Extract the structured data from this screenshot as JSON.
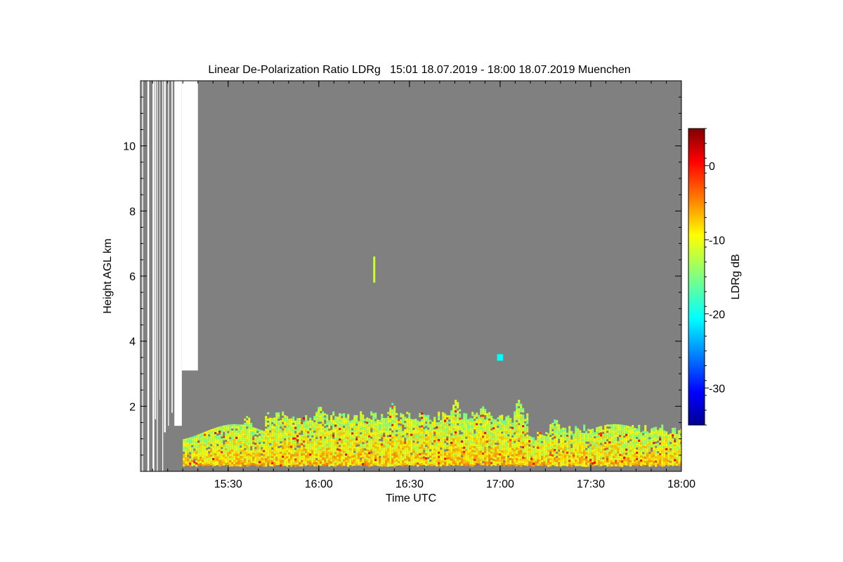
{
  "chart_data": {
    "type": "heatmap",
    "title": "Linear De-Polarization Ratio LDRg   15:01 18.07.2019 - 18:00 18.07.2019 Muenchen",
    "xlabel": "Time UTC",
    "ylabel": "Height AGL km",
    "x_range": [
      "15:01",
      "18:00"
    ],
    "y_range": [
      0,
      12
    ],
    "x_ticks": [
      "15:30",
      "16:00",
      "16:30",
      "17:00",
      "17:30",
      "18:00"
    ],
    "y_ticks": [
      2,
      4,
      6,
      8,
      10
    ],
    "grid": false,
    "background_color": "#808080",
    "colorbar": {
      "label": "LDRg dB",
      "range": [
        -35,
        5
      ],
      "ticks": [
        0,
        -10,
        -20,
        -30
      ],
      "tick_labels": [
        "0",
        "-10",
        "-20",
        "-30"
      ],
      "colormap": "jet"
    },
    "regions": [
      {
        "name": "no-data gaps",
        "x": [
          "15:01",
          "15:20"
        ],
        "y": [
          0,
          12
        ],
        "color": "#ffffff"
      },
      {
        "name": "boundary-layer scatter",
        "x": [
          "15:15",
          "18:00"
        ],
        "y": [
          0.2,
          2.4
        ],
        "ldr_db_typical": [
          -15,
          -8
        ]
      },
      {
        "name": "isolated feature",
        "x": [
          "16:18",
          "16:18"
        ],
        "y": [
          5.8,
          6.6
        ],
        "ldr_db": -12
      },
      {
        "name": "isolated feature",
        "x": [
          "16:59",
          "17:01"
        ],
        "y": [
          3.4,
          3.6
        ],
        "ldr_db": -20
      }
    ]
  }
}
